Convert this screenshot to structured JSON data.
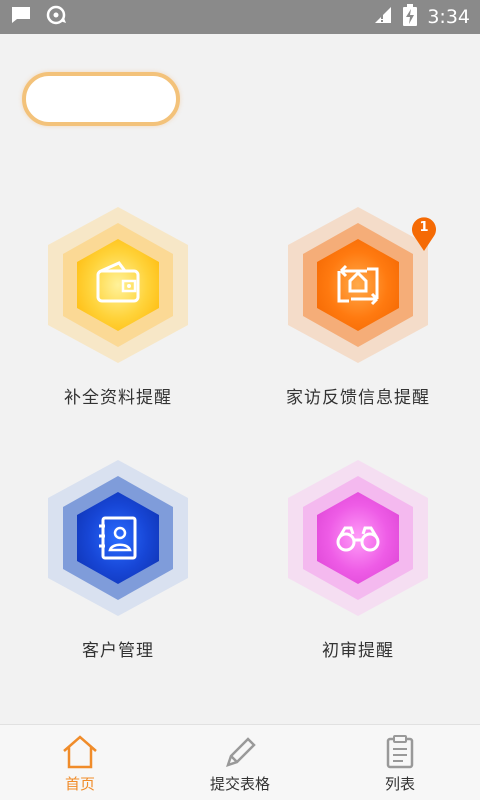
{
  "status_bar": {
    "time": "3:34",
    "icons": [
      "chat-icon",
      "sync-disc-icon",
      "signal-icon",
      "battery-charging-icon"
    ]
  },
  "top_pill": {
    "text": ""
  },
  "tiles": [
    {
      "label": "补全资料提醒",
      "icon": "wallet-icon",
      "color": "#ffc21a"
    },
    {
      "label": "家访反馈信息提醒",
      "icon": "home-transfer-icon",
      "color": "#f5740a",
      "badge": "1"
    },
    {
      "label": "客户管理",
      "icon": "contact-book-icon",
      "color": "#1848d8"
    },
    {
      "label": "初审提醒",
      "icon": "binoculars-icon",
      "color": "#e050d8"
    }
  ],
  "bottom_nav": {
    "items": [
      {
        "label": "首页",
        "icon": "home-icon",
        "active": true
      },
      {
        "label": "提交表格",
        "icon": "pencil-icon",
        "active": false
      },
      {
        "label": "列表",
        "icon": "clipboard-icon",
        "active": false
      }
    ]
  },
  "colors": {
    "accent": "#f08c2a",
    "pill_border": "#f3c27a"
  }
}
